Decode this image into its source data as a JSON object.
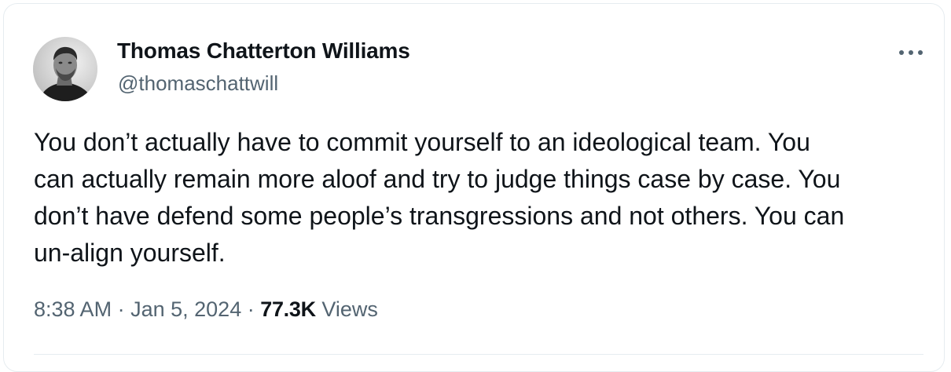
{
  "author": {
    "name": "Thomas Chatterton Williams",
    "handle": "@thomaschattwill"
  },
  "tweet": {
    "lines": [
      "You don’t actually have to commit yourself to an ideological team. You",
      "can actually remain more aloof and try to judge things case by case. You",
      "don’t have defend some people’s transgressions and not others. You can",
      "un-align yourself."
    ]
  },
  "meta": {
    "time": "8:38 AM",
    "separator": "·",
    "date": "Jan 5, 2024",
    "views_count": "77.3K",
    "views_label": "Views"
  },
  "icons": {
    "more": "more-horizontal-icon"
  },
  "colors": {
    "text_primary": "#0f1419",
    "text_secondary": "#536471",
    "border": "#e6ecf0"
  }
}
